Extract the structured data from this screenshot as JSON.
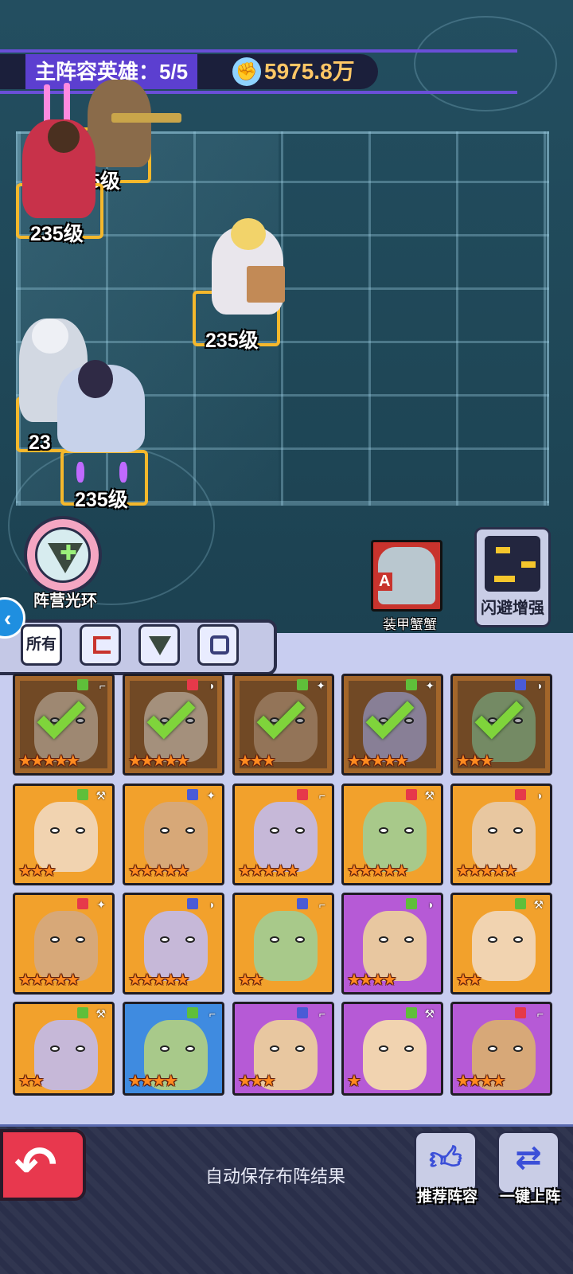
{
  "header": {
    "title": "主阵容英雄：5/5",
    "power_value": "5975.8万",
    "power_icon": "fist-power-icon"
  },
  "battlefield": {
    "heroes": [
      {
        "name": "gunner",
        "level_label": "235级",
        "shown_label": "5级"
      },
      {
        "name": "red-robe",
        "level_label": "235级"
      },
      {
        "name": "blonde-captain",
        "level_label": "235级"
      },
      {
        "name": "robot",
        "level_label": "235级",
        "shown_label": "23"
      },
      {
        "name": "hover-girl",
        "level_label": "235级"
      }
    ]
  },
  "aura": {
    "label": "阵营光环",
    "icon": "faction-aura-icon"
  },
  "crab": {
    "label": "装甲蟹蟹",
    "grade": "A"
  },
  "dodge": {
    "label": "闪避增强",
    "icon": "dodge-icon"
  },
  "filters": {
    "all_label": "所有",
    "tabs": [
      "faction-red-icon",
      "faction-green-icon",
      "faction-blue-icon"
    ]
  },
  "roster": {
    "rows": [
      [
        {
          "stars": "★★★★★",
          "selected": true,
          "faction": "#5fbf3a",
          "class_icon": "gun-icon",
          "bg": "#a3662a"
        },
        {
          "stars": "★★★★★",
          "selected": true,
          "faction": "#e6394a",
          "class_icon": "shield-icon",
          "bg": "#a3662a"
        },
        {
          "stars": "★★★",
          "selected": true,
          "faction": "#5fbf3a",
          "class_icon": "wand-icon",
          "bg": "#a3662a"
        },
        {
          "stars": "★★★★★",
          "selected": true,
          "faction": "#5fbf3a",
          "class_icon": "wand-icon",
          "bg": "#a3662a"
        },
        {
          "stars": "★★★",
          "selected": true,
          "faction": "#4a5bd6",
          "class_icon": "shield-icon",
          "bg": "#a3662a"
        }
      ],
      [
        {
          "stars": "★★★",
          "selected": false,
          "faction": "#5fbf3a",
          "class_icon": "axe-icon",
          "bg": "#f2a12c"
        },
        {
          "stars": "★★★★★",
          "selected": false,
          "faction": "#4a5bd6",
          "class_icon": "wand-icon",
          "bg": "#f2a12c"
        },
        {
          "stars": "★★★★★",
          "selected": false,
          "faction": "#e6394a",
          "class_icon": "gun-icon",
          "bg": "#f2a12c"
        },
        {
          "stars": "★★★★★",
          "selected": false,
          "faction": "#e6394a",
          "class_icon": "axe-icon",
          "bg": "#f2a12c"
        },
        {
          "stars": "★★★★★",
          "selected": false,
          "faction": "#e6394a",
          "class_icon": "shield-icon",
          "bg": "#f2a12c"
        }
      ],
      [
        {
          "stars": "★★★★★",
          "selected": false,
          "faction": "#e6394a",
          "class_icon": "wand-icon",
          "bg": "#f2a12c"
        },
        {
          "stars": "★★★★★",
          "selected": false,
          "faction": "#4a5bd6",
          "class_icon": "shield-icon",
          "bg": "#f2a12c"
        },
        {
          "stars": "★★",
          "selected": false,
          "faction": "#4a5bd6",
          "class_icon": "gun-icon",
          "bg": "#f2a12c"
        },
        {
          "stars": "★★★★",
          "selected": false,
          "faction": "#5fbf3a",
          "class_icon": "shield-icon",
          "bg": "#b65ad6"
        },
        {
          "stars": "★★",
          "selected": false,
          "faction": "#5fbf3a",
          "class_icon": "axe-icon",
          "bg": "#f2a12c"
        }
      ],
      [
        {
          "stars": "★★",
          "selected": false,
          "faction": "#5fbf3a",
          "class_icon": "axe-icon",
          "bg": "#f2a12c"
        },
        {
          "stars": "★★★★",
          "selected": false,
          "faction": "#5fbf3a",
          "class_icon": "gun-icon",
          "bg": "#3f8be0"
        },
        {
          "stars": "★★★",
          "selected": false,
          "faction": "#4a5bd6",
          "class_icon": "gun-icon",
          "bg": "#b65ad6"
        },
        {
          "stars": "★",
          "selected": false,
          "faction": "#5fbf3a",
          "class_icon": "axe-icon",
          "bg": "#b65ad6"
        },
        {
          "stars": "★★★★",
          "selected": false,
          "faction": "#e6394a",
          "class_icon": "gun-icon",
          "bg": "#b65ad6"
        }
      ]
    ]
  },
  "footer": {
    "back_icon": "back-arrow-icon",
    "autosave_text": "自动保存布阵结果",
    "recommend_label": "推荐阵容",
    "recommend_icon": "thumbs-up-icon",
    "one_click_label": "一键上阵",
    "one_click_icon": "swap-icon"
  }
}
